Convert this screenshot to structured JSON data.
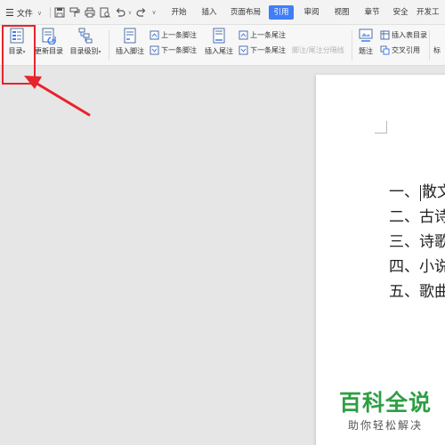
{
  "menubar": {
    "file_label": "文件",
    "tabs": [
      "开始",
      "插入",
      "页面布局",
      "引用",
      "审阅",
      "视图",
      "章节",
      "安全",
      "开发工"
    ],
    "active_tab": "引用"
  },
  "ribbon": {
    "toc": "目录",
    "update_toc": "更新目录",
    "toc_level": "目录级别",
    "insert_footnote": "插入脚注",
    "prev_footnote": "上一条脚注",
    "next_footnote": "下一条脚注",
    "insert_endnote": "插入尾注",
    "prev_endnote": "上一条尾注",
    "next_endnote": "下一条尾注",
    "separator": "脚注/尾注分隔线",
    "caption": "题注",
    "insert_table_toc": "插入表目录",
    "cross_ref": "交叉引用",
    "mark": "标"
  },
  "document": {
    "toc_items": [
      {
        "num": "一、",
        "text": "散文"
      },
      {
        "num": "二、",
        "text": "古诗"
      },
      {
        "num": "三、",
        "text": "诗歌"
      },
      {
        "num": "四、",
        "text": "小说"
      },
      {
        "num": "五、",
        "text": "歌曲"
      }
    ]
  },
  "watermark": {
    "main": "百科全说",
    "sub": "助你轻松解决"
  },
  "colors": {
    "accent": "#3f7ef6",
    "annotation": "#e8232b",
    "watermark": "#2e9f44"
  }
}
